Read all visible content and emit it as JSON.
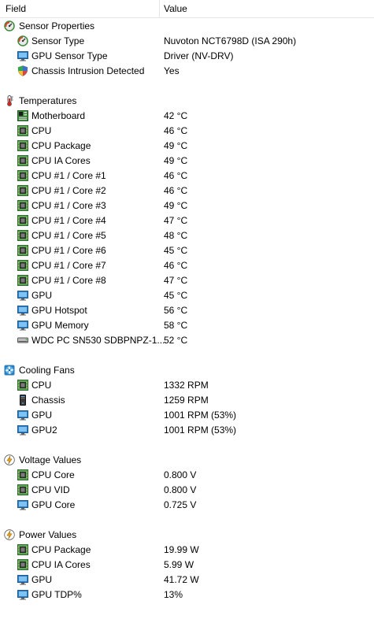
{
  "header": {
    "field_label": "Field",
    "value_label": "Value"
  },
  "rows": [
    {
      "kind": "section",
      "icon": "sensor-gauge-icon",
      "label": "Sensor Properties",
      "value": ""
    },
    {
      "kind": "item",
      "icon": "sensor-gauge-icon",
      "label": "Sensor Type",
      "value": "Nuvoton NCT6798D  (ISA 290h)"
    },
    {
      "kind": "item",
      "icon": "monitor-icon",
      "label": "GPU Sensor Type",
      "value": "Driver  (NV-DRV)"
    },
    {
      "kind": "item",
      "icon": "shield-icon",
      "label": "Chassis Intrusion Detected",
      "value": "Yes"
    },
    {
      "kind": "blank"
    },
    {
      "kind": "section",
      "icon": "thermometer-icon",
      "label": "Temperatures",
      "value": ""
    },
    {
      "kind": "item",
      "icon": "motherboard-icon",
      "label": "Motherboard",
      "value": "42 °C"
    },
    {
      "kind": "item",
      "icon": "cpu-chip-icon",
      "label": "CPU",
      "value": "46 °C"
    },
    {
      "kind": "item",
      "icon": "cpu-chip-icon",
      "label": "CPU Package",
      "value": "49 °C"
    },
    {
      "kind": "item",
      "icon": "cpu-chip-icon",
      "label": "CPU IA Cores",
      "value": "49 °C"
    },
    {
      "kind": "item",
      "icon": "cpu-chip-icon",
      "label": "CPU #1 / Core #1",
      "value": "46 °C"
    },
    {
      "kind": "item",
      "icon": "cpu-chip-icon",
      "label": "CPU #1 / Core #2",
      "value": "46 °C"
    },
    {
      "kind": "item",
      "icon": "cpu-chip-icon",
      "label": "CPU #1 / Core #3",
      "value": "49 °C"
    },
    {
      "kind": "item",
      "icon": "cpu-chip-icon",
      "label": "CPU #1 / Core #4",
      "value": "47 °C"
    },
    {
      "kind": "item",
      "icon": "cpu-chip-icon",
      "label": "CPU #1 / Core #5",
      "value": "48 °C"
    },
    {
      "kind": "item",
      "icon": "cpu-chip-icon",
      "label": "CPU #1 / Core #6",
      "value": "45 °C"
    },
    {
      "kind": "item",
      "icon": "cpu-chip-icon",
      "label": "CPU #1 / Core #7",
      "value": "46 °C"
    },
    {
      "kind": "item",
      "icon": "cpu-chip-icon",
      "label": "CPU #1 / Core #8",
      "value": "47 °C"
    },
    {
      "kind": "item",
      "icon": "monitor-icon",
      "label": "GPU",
      "value": "45 °C"
    },
    {
      "kind": "item",
      "icon": "monitor-icon",
      "label": "GPU Hotspot",
      "value": "56 °C"
    },
    {
      "kind": "item",
      "icon": "monitor-icon",
      "label": "GPU Memory",
      "value": "58 °C"
    },
    {
      "kind": "item",
      "icon": "drive-icon",
      "label": "WDC PC SN530 SDBPNPZ-1...",
      "value": "52 °C"
    },
    {
      "kind": "blank"
    },
    {
      "kind": "section",
      "icon": "fan-icon",
      "label": "Cooling Fans",
      "value": ""
    },
    {
      "kind": "item",
      "icon": "cpu-chip-icon",
      "label": "CPU",
      "value": "1332 RPM"
    },
    {
      "kind": "item",
      "icon": "chassis-icon",
      "label": "Chassis",
      "value": "1259 RPM"
    },
    {
      "kind": "item",
      "icon": "monitor-icon",
      "label": "GPU",
      "value": "1001 RPM  (53%)"
    },
    {
      "kind": "item",
      "icon": "monitor-icon",
      "label": "GPU2",
      "value": "1001 RPM  (53%)"
    },
    {
      "kind": "blank"
    },
    {
      "kind": "section",
      "icon": "bolt-icon",
      "label": "Voltage Values",
      "value": ""
    },
    {
      "kind": "item",
      "icon": "cpu-chip-icon",
      "label": "CPU Core",
      "value": "0.800 V"
    },
    {
      "kind": "item",
      "icon": "cpu-chip-icon",
      "label": "CPU VID",
      "value": "0.800 V"
    },
    {
      "kind": "item",
      "icon": "monitor-icon",
      "label": "GPU Core",
      "value": "0.725 V"
    },
    {
      "kind": "blank"
    },
    {
      "kind": "section",
      "icon": "bolt-icon",
      "label": "Power Values",
      "value": ""
    },
    {
      "kind": "item",
      "icon": "cpu-chip-icon",
      "label": "CPU Package",
      "value": "19.99 W"
    },
    {
      "kind": "item",
      "icon": "cpu-chip-icon",
      "label": "CPU IA Cores",
      "value": "5.99 W"
    },
    {
      "kind": "item",
      "icon": "monitor-icon",
      "label": "GPU",
      "value": "41.72 W"
    },
    {
      "kind": "item",
      "icon": "monitor-icon",
      "label": "GPU TDP%",
      "value": "13%"
    }
  ]
}
